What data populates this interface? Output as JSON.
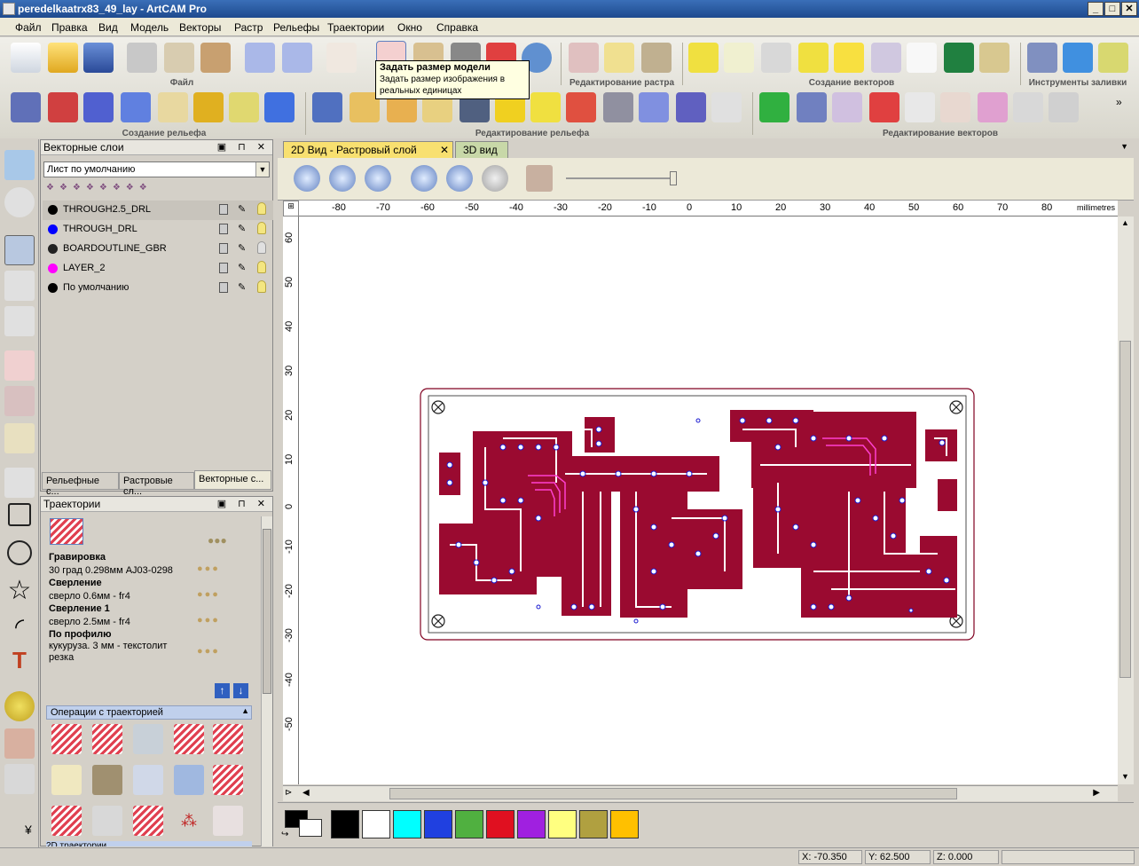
{
  "window": {
    "title": "peredelkaatrx83_49_lay - ArtCAM Pro",
    "controls": [
      "_",
      "□",
      "✕"
    ]
  },
  "menu": [
    "Файл",
    "Правка",
    "Вид",
    "Модель",
    "Векторы",
    "Растр",
    "Рельефы",
    "Траектории",
    "Окно",
    "Справка"
  ],
  "toolbar_groups": {
    "row1": [
      "Файл",
      "Редактирование растра",
      "Создание векторов",
      "Инструменты заливки"
    ],
    "row2": [
      "Создание рельефа",
      "Редактирование рельефа",
      "Редактирование векторов"
    ]
  },
  "tooltip": {
    "title": "Задать размер модели",
    "text": "Задать размер изображения в реальных единицах"
  },
  "vector_layers": {
    "title": "Векторные слои",
    "sheet_selected": "Лист по умолчанию",
    "layers": [
      {
        "name": "THROUGH2.5_DRL",
        "color": "#000000"
      },
      {
        "name": "THROUGH_DRL",
        "color": "#0000ff"
      },
      {
        "name": "BOARDOUTLINE_GBR",
        "color": "#222222"
      },
      {
        "name": "LAYER_2",
        "color": "#ff00ff"
      },
      {
        "name": "По умолчанию",
        "color": "#000000"
      }
    ],
    "tabs": [
      "Рельефные с...",
      "Растровые сл...",
      "Векторные с..."
    ]
  },
  "toolpaths": {
    "title": "Траектории",
    "items": [
      {
        "name": "Гравировка",
        "detail": "30 град 0.298мм AJ03-0298"
      },
      {
        "name": "Сверление",
        "detail": "сверло 0.6мм - fr4"
      },
      {
        "name": "Сверление 1",
        "detail": "сверло 2.5мм - fr4"
      },
      {
        "name": "По профилю",
        "detail": "кукуруза. 3 мм - текстолит резка"
      }
    ],
    "operations_title": "Операции с траекторией",
    "next_section": "2D траектории"
  },
  "view_tabs": [
    "2D Вид - Растровый слой",
    "3D вид"
  ],
  "ruler": {
    "units": "millimetres",
    "x_ticks": [
      "-80",
      "-70",
      "-60",
      "-50",
      "-40",
      "-30",
      "-20",
      "-10",
      "0",
      "10",
      "20",
      "30",
      "40",
      "50",
      "60",
      "70",
      "80"
    ],
    "y_ticks": [
      "60",
      "50",
      "40",
      "30",
      "20",
      "10",
      "0",
      "-10",
      "-20",
      "-30",
      "-40",
      "-50"
    ]
  },
  "palette": [
    "#000000",
    "#ffffff",
    "#00ffff",
    "#2040e0",
    "#50b040",
    "#e01020",
    "#a020e0",
    "#ffff80",
    "#b0a040",
    "#ffc000"
  ],
  "status": {
    "x": "X: -70.350",
    "y": "Y: 62.500",
    "z": "Z: 0.000"
  }
}
